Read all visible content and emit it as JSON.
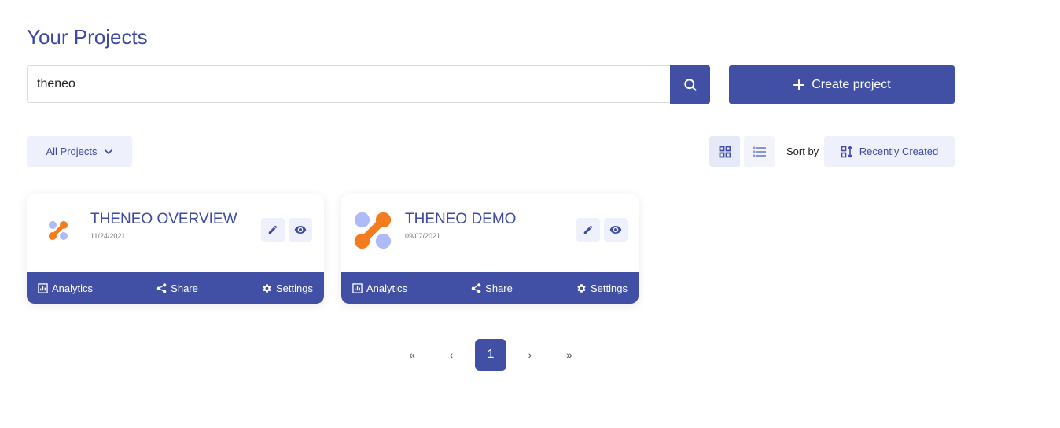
{
  "header": {
    "title": "Your Projects"
  },
  "search": {
    "value": "theneo",
    "placeholder": ""
  },
  "actions": {
    "create_label": "Create project"
  },
  "filter": {
    "label": "All Projects"
  },
  "sort": {
    "label": "Sort by",
    "value": "Recently Created"
  },
  "projects": [
    {
      "name": "THENEO OVERVIEW",
      "date": "11/24/2021",
      "analytics": "Analytics",
      "share": "Share",
      "settings": "Settings"
    },
    {
      "name": "THENEO DEMO",
      "date": "09/07/2021",
      "analytics": "Analytics",
      "share": "Share",
      "settings": "Settings"
    }
  ],
  "pagination": {
    "first": "«",
    "prev": "‹",
    "current": "1",
    "next": "›",
    "last": "»"
  },
  "colors": {
    "primary": "#4150a4",
    "light": "#eef1fb",
    "accent_orange": "#f47c20",
    "accent_blue": "#a5b4f5"
  }
}
